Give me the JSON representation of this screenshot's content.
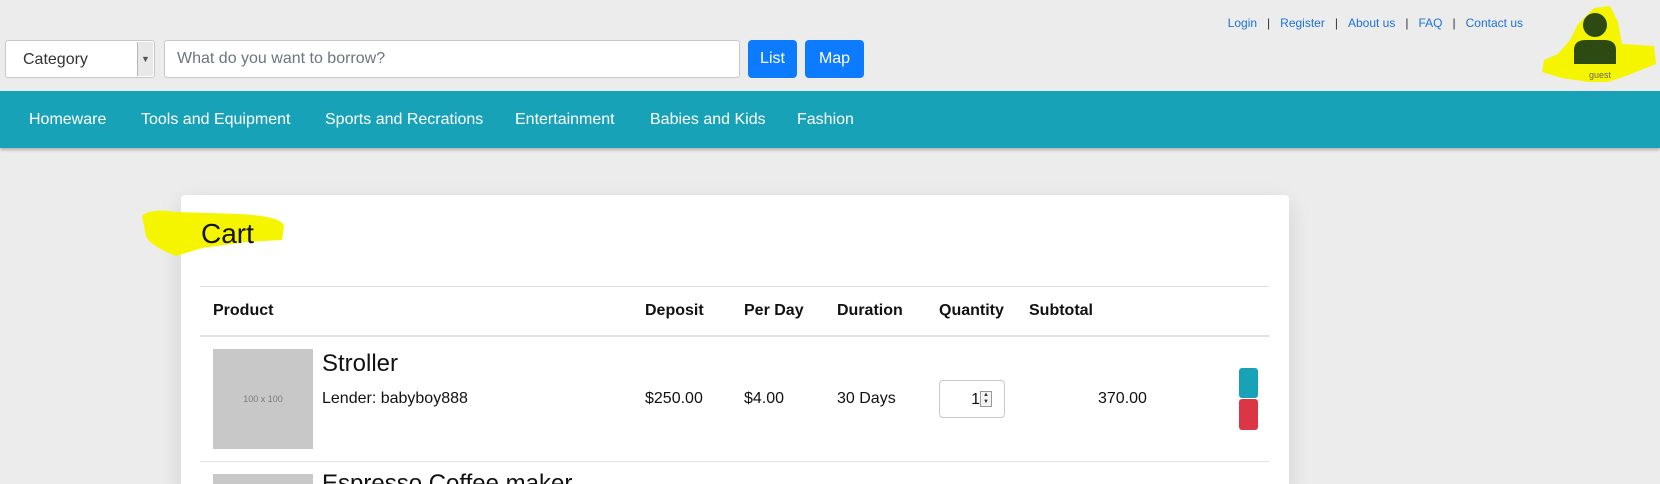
{
  "header": {
    "links": [
      "Login",
      "Register",
      "About us",
      "FAQ",
      "Contact us"
    ],
    "category_select": "Category",
    "search_placeholder": "What do you want to borrow?",
    "list_button": "List",
    "map_button": "Map",
    "user_label": "guest"
  },
  "nav": {
    "items": [
      "Homeware",
      "Tools and Equipment",
      "Sports and Recrations",
      "Entertainment",
      "Babies and Kids",
      "Fashion"
    ]
  },
  "cart": {
    "title": "Cart",
    "columns": [
      "Product",
      "Deposit",
      "Per Day",
      "Duration",
      "Quantity",
      "Subtotal"
    ],
    "rows": [
      {
        "thumb": "100 x 100",
        "name": "Stroller",
        "lender": "Lender: babyboy888",
        "deposit": "$250.00",
        "per_day": "$4.00",
        "duration": "30 Days",
        "quantity": "1",
        "subtotal": "370.00"
      },
      {
        "name": "Espresso Coffee maker"
      }
    ]
  },
  "colors": {
    "nav_bg": "#17a2b8",
    "primary": "#0d7bff",
    "danger": "#dc3545",
    "highlight": "#f5f500",
    "avatar": "#2d4a12"
  }
}
